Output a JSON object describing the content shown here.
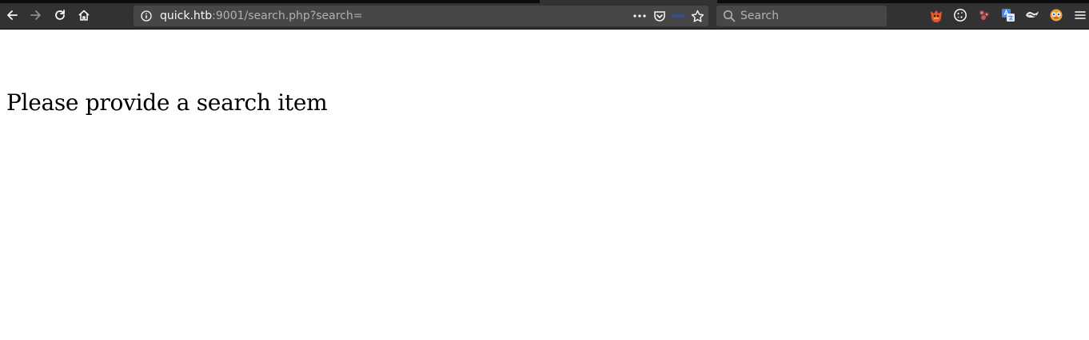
{
  "browser": {
    "url_host": "quick.htb",
    "url_rest": ":9001/search.php?search=",
    "search_placeholder": "Search",
    "icons": {
      "back": "back-arrow-icon",
      "forward": "forward-arrow-icon",
      "reload": "reload-icon",
      "home": "home-icon",
      "site_info": "info-icon",
      "page_actions": "more-dots-icon",
      "pocket": "pocket-icon",
      "bookmark": "star-icon",
      "search": "magnifier-icon",
      "menu": "hamburger-menu-icon"
    },
    "extensions": [
      "foxyproxy-icon",
      "cookie-icon",
      "paw-icon",
      "translate-icon",
      "wappalyzer-icon",
      "face-icon"
    ]
  },
  "page": {
    "message": "Please provide a search item"
  },
  "colors": {
    "toolbar_bg": "#323234",
    "urlbar_bg": "#474749",
    "page_bg": "#ffffff",
    "text": "#000000"
  }
}
